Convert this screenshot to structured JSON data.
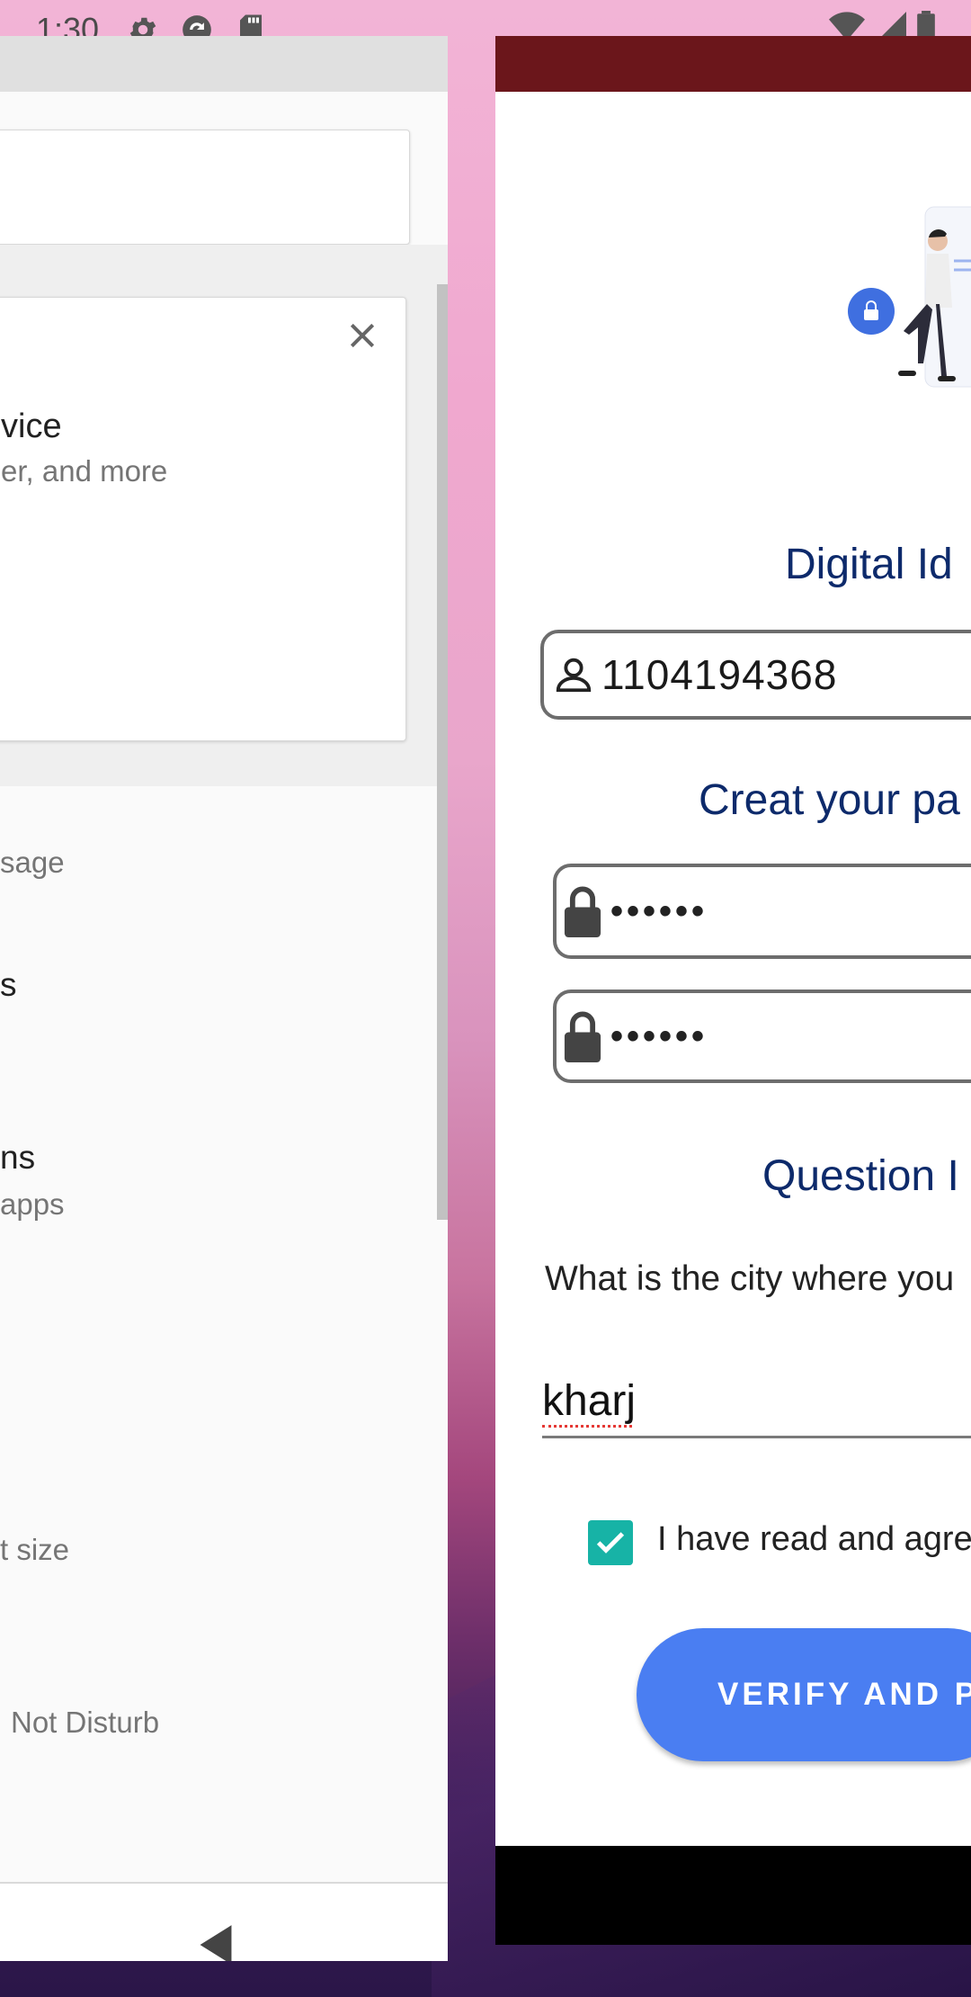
{
  "status_bar": {
    "time": "1:30",
    "icons": [
      "settings-icon",
      "sync-icon",
      "sd-card-icon",
      "wifi-icon",
      "signal-icon",
      "battery-icon"
    ]
  },
  "settings_window": {
    "suggestion": {
      "title_fragment": "vice",
      "subtitle_fragment": "er, and more"
    },
    "items": [
      {
        "text": "sage",
        "kind": "subtitle"
      },
      {
        "text": "s",
        "kind": "title"
      },
      {
        "text": "ns",
        "kind": "title"
      },
      {
        "text": "apps",
        "kind": "subtitle"
      },
      {
        "text": "t size",
        "kind": "subtitle"
      },
      {
        "text": "Not Disturb",
        "kind": "subtitle"
      }
    ]
  },
  "app_window": {
    "digital_id_heading": "Digital Id",
    "id_value": "1104194368",
    "create_password_heading": "Creat  your pa",
    "password_mask": "••••••",
    "confirm_password_mask": "••••••",
    "question_heading": "Question I",
    "question_text": "What is the city where you",
    "answer_value": "kharj",
    "agree_text": "I have read and agree",
    "verify_button": "VERIFY AND PI",
    "colors": {
      "appbar": "#6b161b",
      "heading": "#0d2a6b",
      "button": "#4a7ef2",
      "checkbox": "#17b3a6"
    }
  }
}
